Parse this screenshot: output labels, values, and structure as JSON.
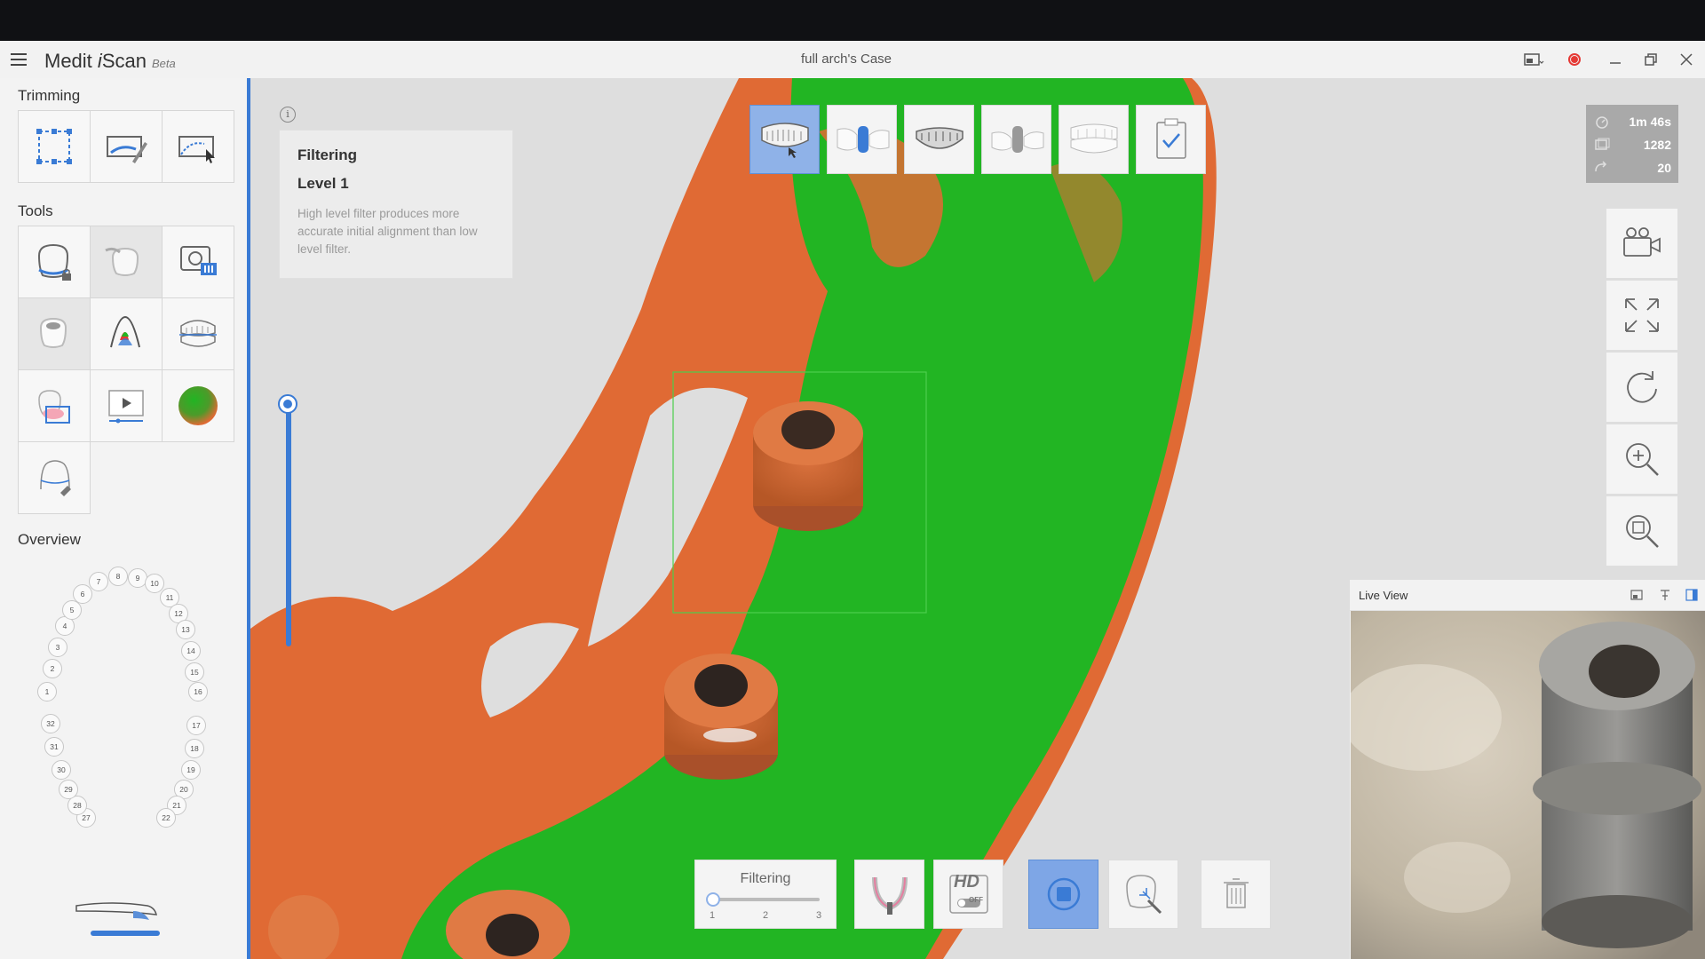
{
  "titlebar": {
    "app_name_prefix": "Medit ",
    "app_name_italic": "i",
    "app_name_suffix": "Scan",
    "app_beta": "Beta",
    "case_title": "full arch's Case"
  },
  "sidebar": {
    "trimming_title": "Trimming",
    "tools_title": "Tools",
    "overview_title": "Overview",
    "trimming_tools": [
      "select-area-tool-icon",
      "brush-trim-icon",
      "lasso-trim-icon"
    ],
    "tools": [
      "lock-area-icon",
      "tooth-tool-icon",
      "screen-capture-icon",
      "smart-tooth-icon",
      "color-analysis-icon",
      "occlusion-icon",
      "overlay-compare-icon",
      "replay-icon",
      "color-display-icon",
      "margin-line-icon"
    ],
    "teeth": [
      "1",
      "2",
      "3",
      "4",
      "5",
      "6",
      "7",
      "8",
      "9",
      "10",
      "11",
      "12",
      "13",
      "14",
      "15",
      "16",
      "17",
      "18",
      "19",
      "20",
      "21",
      "22",
      "27",
      "28",
      "29",
      "30",
      "31",
      "32"
    ]
  },
  "info_panel": {
    "icon": "i",
    "title": "Filtering",
    "level": "Level 1",
    "description": "High level filter produces more accurate initial alignment than low level filter."
  },
  "stages": [
    "maxilla-stage",
    "maxilla-scanbody-stage",
    "mandible-stage",
    "mandible-scanbody-stage",
    "occlusion-stage",
    "complete-stage"
  ],
  "stats": {
    "time": "1m 46s",
    "frames": "1282",
    "rotations": "20"
  },
  "right_tools": [
    "camera-view-icon",
    "fit-screen-icon",
    "reset-view-icon",
    "zoom-in-icon",
    "zoom-fit-icon"
  ],
  "live_view": {
    "title": "Live View"
  },
  "bottom": {
    "filter_label": "Filtering",
    "filter_ticks": [
      "1",
      "2",
      "3"
    ],
    "filter_value": 1,
    "hd_label": "HD",
    "hd_sub": "OFF"
  },
  "colors": {
    "accent": "#3a7bd5",
    "scan_green": "#22b523",
    "scan_orange": "#e06a34",
    "record_red": "#e53935"
  }
}
